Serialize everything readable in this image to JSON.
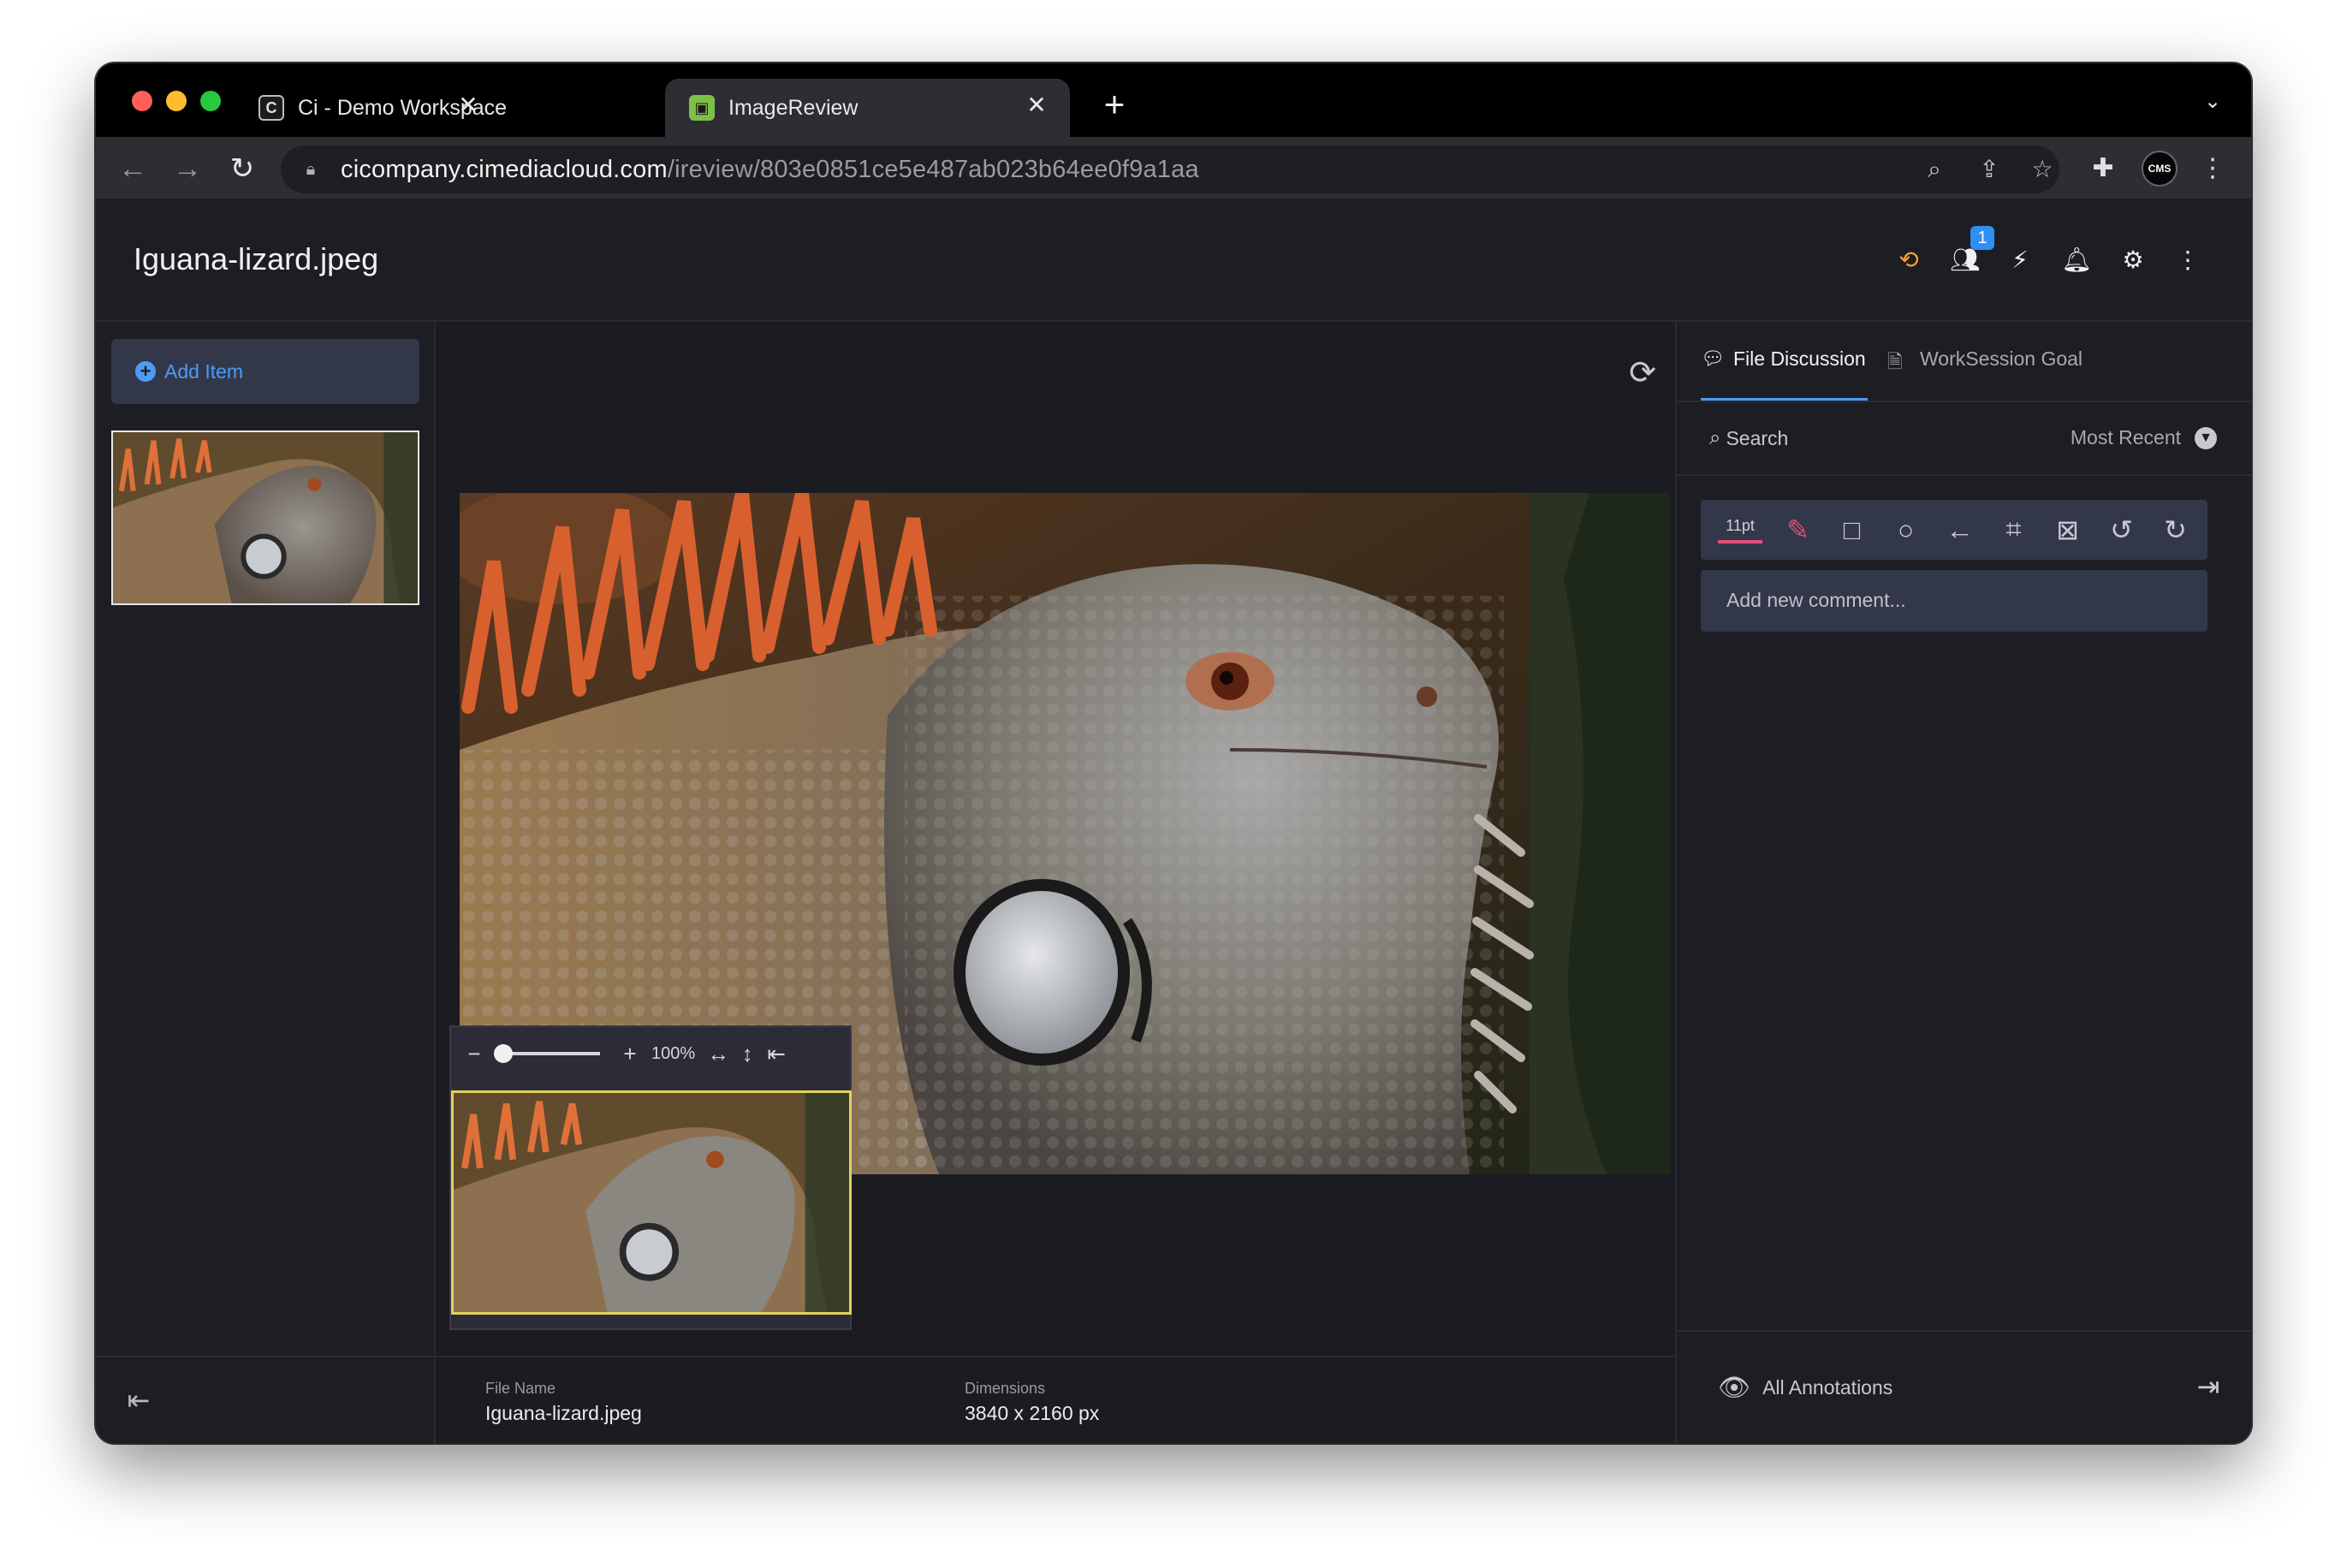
{
  "browser": {
    "tabs": [
      {
        "title": "Ci - Demo Workspace",
        "favicon": "ci-logo-icon",
        "active": false
      },
      {
        "title": "ImageReview",
        "favicon": "image-review-icon",
        "active": true
      }
    ],
    "new_tab": "+",
    "url_host": "cicompany.cimediacloud.com",
    "url_path": "/ireview/803e0851ce5e487ab023b64ee0f9a1aa",
    "profile_initials": "CMS"
  },
  "header": {
    "file_title": "Iguana-lizard.jpeg",
    "users_badge": "1",
    "accent_color": "#f6a031"
  },
  "sidebar": {
    "add_item_label": "Add Item"
  },
  "viewer": {
    "zoom_level": "100%",
    "zoom_slider_fraction": 0.0,
    "meta": {
      "file_name_label": "File Name",
      "file_name_value": "Iguana-lizard.jpeg",
      "dimensions_label": "Dimensions",
      "dimensions_value": "3840 x 2160 px"
    }
  },
  "panel": {
    "tabs": [
      {
        "label": "File Discussion",
        "active": true
      },
      {
        "label": "WorkSession Goal",
        "active": false
      }
    ],
    "search_label": "Search",
    "sort_label": "Most Recent",
    "annotation": {
      "size_label": "11pt",
      "pen_color": "#e0507a",
      "tools": [
        "pencil-icon",
        "rectangle-icon",
        "circle-icon",
        "arrow-icon",
        "crop-icon",
        "clear-icon",
        "undo-icon",
        "redo-icon"
      ]
    },
    "comment_placeholder": "Add new comment...",
    "all_annotations_label": "All Annotations"
  }
}
